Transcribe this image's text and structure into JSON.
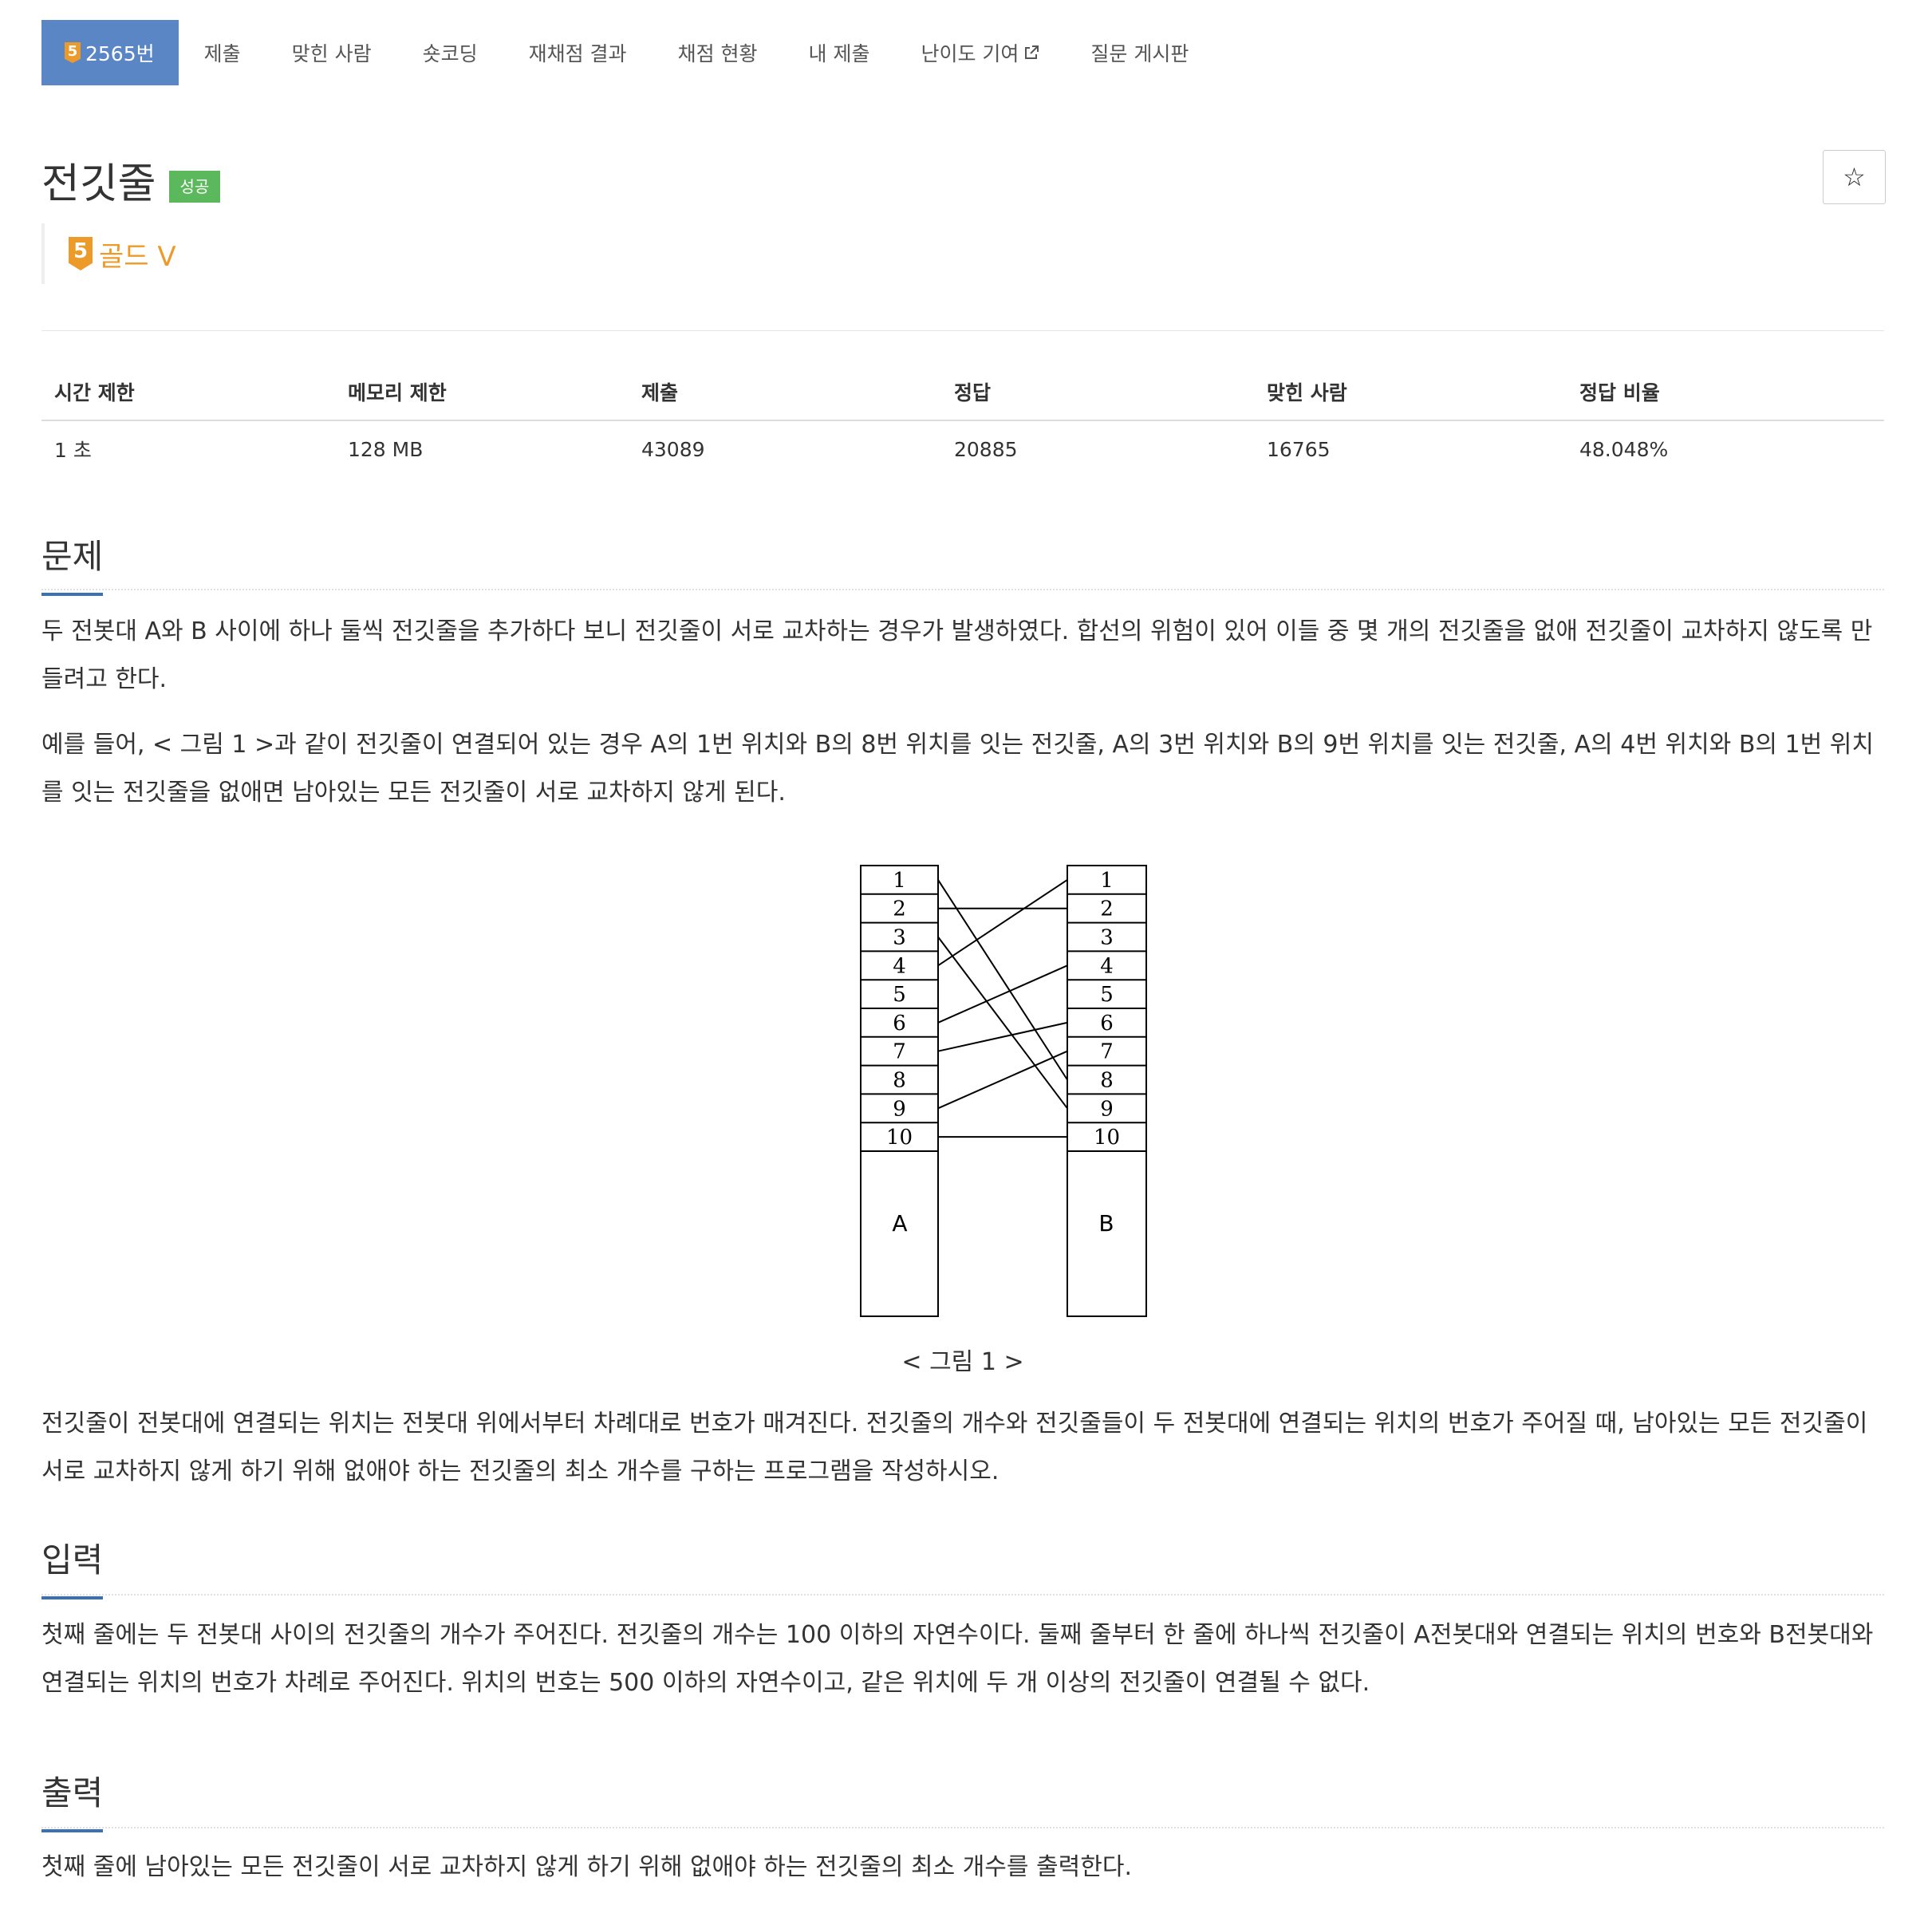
{
  "tabs": {
    "problem_tier_digit": "5",
    "problem_number": "2565번",
    "submit": "제출",
    "solvers": "맞힌 사람",
    "short_coding": "숏코딩",
    "rejudge_results": "재채점 결과",
    "judge_status": "채점 현황",
    "my_submissions": "내 제출",
    "difficulty_contrib": "난이도 기여",
    "qna_board": "질문 게시판"
  },
  "problem": {
    "title": "전깃줄",
    "status_badge": "성공",
    "favorite_icon": "☆",
    "tier_digit": "5",
    "tier_name": "골드 V",
    "tier_color": "#ec9a29"
  },
  "info_table": {
    "headers": [
      "시간 제한",
      "메모리 제한",
      "제출",
      "정답",
      "맞힌 사람",
      "정답 비율"
    ],
    "values": [
      "1 초",
      "128 MB",
      "43089",
      "20885",
      "16765",
      "48.048%"
    ]
  },
  "sections": {
    "problem_heading": "문제",
    "problem_p1": "두 전봇대 A와 B 사이에 하나 둘씩 전깃줄을 추가하다 보니 전깃줄이 서로 교차하는 경우가 발생하였다. 합선의 위험이 있어 이들 중 몇 개의 전깃줄을 없애 전깃줄이 교차하지 않도록 만들려고 한다.",
    "problem_p2": "예를 들어, < 그림 1 >과 같이 전깃줄이 연결되어 있는 경우 A의 1번 위치와 B의 8번 위치를 잇는 전깃줄, A의 3번 위치와 B의 9번 위치를 잇는 전깃줄, A의 4번 위치와 B의 1번 위치를 잇는 전깃줄을 없애면 남아있는 모든 전깃줄이 서로 교차하지 않게 된다.",
    "figure_caption": "< 그림 1 >",
    "problem_p3": "전깃줄이 전봇대에 연결되는 위치는 전봇대 위에서부터 차례대로 번호가 매겨진다. 전깃줄의 개수와 전깃줄들이 두 전봇대에 연결되는 위치의 번호가 주어질 때, 남아있는 모든 전깃줄이 서로 교차하지 않게 하기 위해 없애야 하는 전깃줄의 최소 개수를 구하는 프로그램을 작성하시오.",
    "input_heading": "입력",
    "input_p": "첫째 줄에는 두 전봇대 사이의 전깃줄의 개수가 주어진다. 전깃줄의 개수는 100 이하의 자연수이다. 둘째 줄부터 한 줄에 하나씩 전깃줄이 A전봇대와 연결되는 위치의 번호와 B전봇대와 연결되는 위치의 번호가 차례로 주어진다. 위치의 번호는 500 이하의 자연수이고, 같은 위치에 두 개 이상의 전깃줄이 연결될 수 없다.",
    "output_heading": "출력",
    "output_p": "첫째 줄에 남아있는 모든 전깃줄이 서로 교차하지 않게 하기 위해 없애야 하는 전깃줄의 최소 개수를 출력한다."
  },
  "figure": {
    "pole_a_label": "A",
    "pole_b_label": "B",
    "slots": [
      "1",
      "2",
      "3",
      "4",
      "5",
      "6",
      "7",
      "8",
      "9",
      "10"
    ],
    "wires": [
      [
        1,
        8
      ],
      [
        2,
        2
      ],
      [
        3,
        9
      ],
      [
        4,
        1
      ],
      [
        6,
        4
      ],
      [
        7,
        6
      ],
      [
        9,
        7
      ],
      [
        10,
        10
      ]
    ]
  }
}
